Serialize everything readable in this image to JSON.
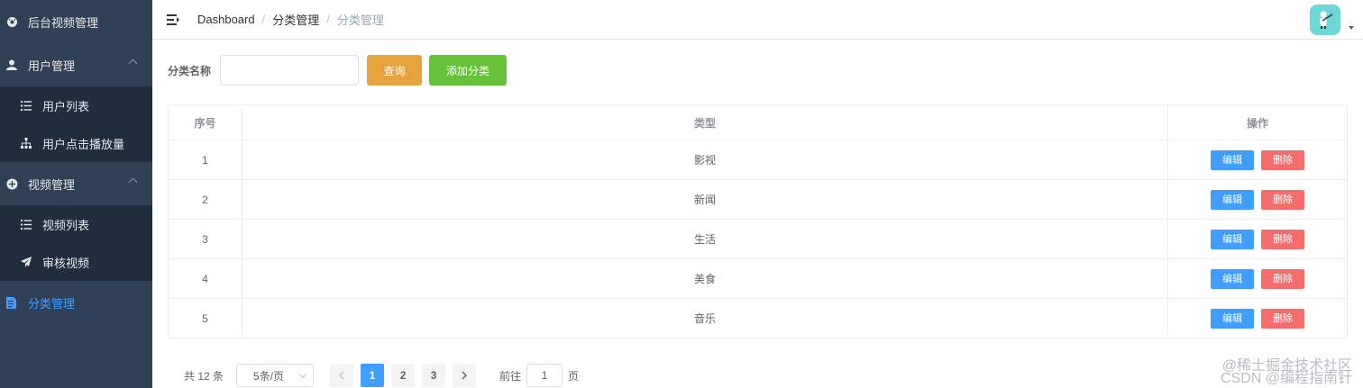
{
  "sidebar": {
    "items": [
      {
        "label": "后台视频管理",
        "icon": "dashboard-icon"
      },
      {
        "label": "用户管理",
        "icon": "user-icon",
        "children": [
          {
            "label": "用户列表",
            "icon": "list-icon"
          },
          {
            "label": "用户点击播放量",
            "icon": "tree-icon"
          }
        ]
      },
      {
        "label": "视频管理",
        "icon": "plus-circle-icon",
        "children": [
          {
            "label": "视频列表",
            "icon": "list-icon"
          },
          {
            "label": "审核视频",
            "icon": "send-icon"
          }
        ]
      },
      {
        "label": "分类管理",
        "icon": "document-icon",
        "active": true
      }
    ]
  },
  "navbar": {
    "breadcrumb": [
      "Dashboard",
      "分类管理",
      "分类管理"
    ],
    "separator": "/"
  },
  "filter": {
    "label": "分类名称",
    "input_value": "",
    "query_label": "查询",
    "add_label": "添加分类"
  },
  "table": {
    "headers": [
      "序号",
      "类型",
      "操作"
    ],
    "rows": [
      {
        "no": "1",
        "type": "影视"
      },
      {
        "no": "2",
        "type": "新闻"
      },
      {
        "no": "3",
        "type": "生活"
      },
      {
        "no": "4",
        "type": "美食"
      },
      {
        "no": "5",
        "type": "音乐"
      }
    ],
    "edit_label": "编辑",
    "delete_label": "删除"
  },
  "pagination": {
    "total_text": "共 12 条",
    "page_size": "5条/页",
    "pages": [
      "1",
      "2",
      "3"
    ],
    "current_page": "1",
    "goto_label": "前往",
    "goto_value": "1",
    "page_unit": "页"
  },
  "watermark": {
    "line1": "@稀土掘金技术社区",
    "line2": "CSDN @编程指南针"
  },
  "colors": {
    "sidebar_bg": "#304156",
    "submenu_bg": "#1f2d3d",
    "primary": "#409eff",
    "warning": "#e6a23c",
    "success": "#67c23a",
    "danger": "#f56c6c"
  }
}
